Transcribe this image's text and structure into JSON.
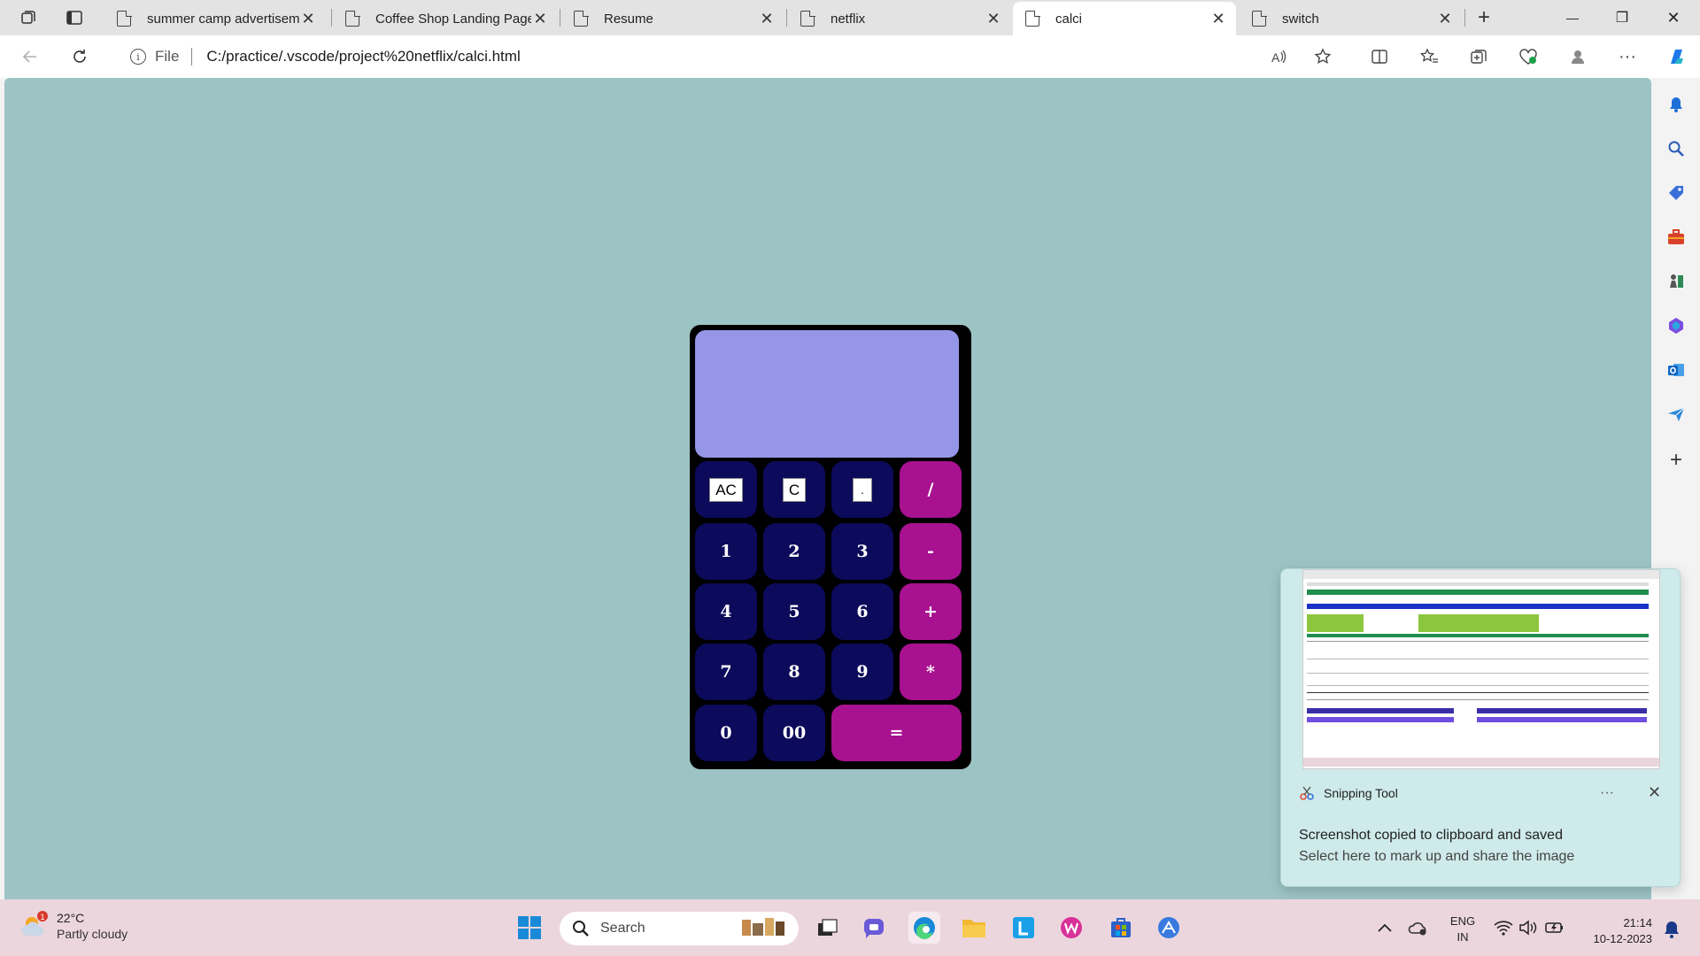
{
  "browser": {
    "tabs": [
      {
        "title": "summer camp advertiseme",
        "active": false
      },
      {
        "title": "Coffee Shop Landing Page",
        "active": false
      },
      {
        "title": "Resume",
        "active": false
      },
      {
        "title": "netflix",
        "active": false
      },
      {
        "title": "calci",
        "active": true
      },
      {
        "title": "switch",
        "active": false
      }
    ],
    "new_tab": "+",
    "tab_close": "✕",
    "address": {
      "scheme_label": "File",
      "url": "C:/practice/.vscode/project%20netflix/calci.html"
    },
    "window_controls": {
      "minimize": "—",
      "maximize": "❐",
      "close": "✕"
    }
  },
  "calculator": {
    "display_value": "",
    "keys": {
      "ac": "AC",
      "c": "C",
      "dot": ".",
      "divide": "/",
      "one": "1",
      "two": "2",
      "three": "3",
      "minus": "-",
      "four": "4",
      "five": "5",
      "six": "6",
      "plus": "+",
      "seven": "7",
      "eight": "8",
      "nine": "9",
      "multiply": "*",
      "zero": "0",
      "double_zero": "00",
      "equals": "="
    },
    "colors": {
      "digit": "#0c0a5a",
      "operator": "#a8118f",
      "display": "#9696e8",
      "page_bg": "#9dc4c4"
    }
  },
  "toast": {
    "app_name": "Snipping Tool",
    "more": "···",
    "close": "✕",
    "message": "Screenshot copied to clipboard and saved",
    "subtext": "Select here to mark up and share the image"
  },
  "taskbar": {
    "weather": {
      "badge": "1",
      "temp": "22°C",
      "desc": "Partly cloudy"
    },
    "search_placeholder": "Search",
    "tray": {
      "lang_line1": "ENG",
      "lang_line2": "IN",
      "time": "21:14",
      "date": "10-12-2023"
    }
  }
}
